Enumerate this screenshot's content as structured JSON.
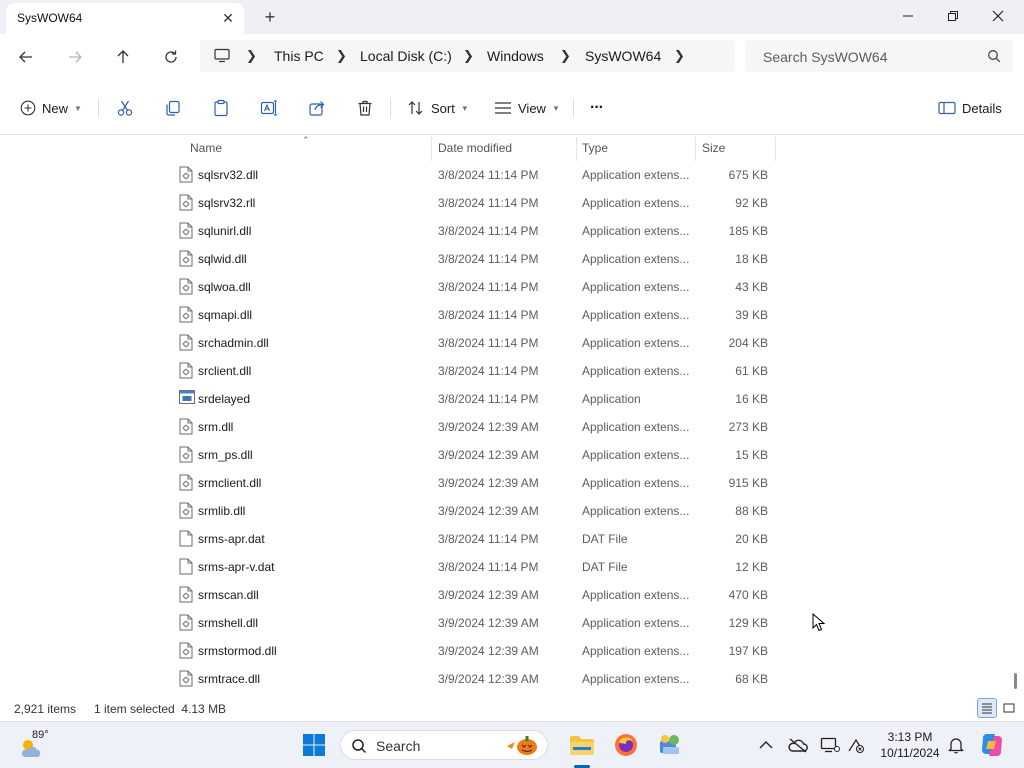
{
  "window": {
    "tab_title": "SysWOW64",
    "tab_close": "✕",
    "new_tab": "+"
  },
  "address": {
    "crumbs": [
      "This PC",
      "Local Disk (C:)",
      "Windows",
      "SysWOW64"
    ],
    "search_placeholder": "Search SysWOW64"
  },
  "toolbar": {
    "new_label": "New",
    "sort_label": "Sort",
    "view_label": "View",
    "more_label": "···",
    "details_label": "Details"
  },
  "columns": {
    "name": "Name",
    "date": "Date modified",
    "type": "Type",
    "size": "Size"
  },
  "files": [
    {
      "name": "sqlsrv32.dll",
      "date": "3/8/2024 11:14 PM",
      "type": "Application extens...",
      "size": "675 KB",
      "icon": "dll-icon"
    },
    {
      "name": "sqlsrv32.rll",
      "date": "3/8/2024 11:14 PM",
      "type": "Application extens...",
      "size": "92 KB",
      "icon": "dll-icon"
    },
    {
      "name": "sqlunirl.dll",
      "date": "3/8/2024 11:14 PM",
      "type": "Application extens...",
      "size": "185 KB",
      "icon": "dll-icon"
    },
    {
      "name": "sqlwid.dll",
      "date": "3/8/2024 11:14 PM",
      "type": "Application extens...",
      "size": "18 KB",
      "icon": "dll-icon"
    },
    {
      "name": "sqlwoa.dll",
      "date": "3/8/2024 11:14 PM",
      "type": "Application extens...",
      "size": "43 KB",
      "icon": "dll-icon"
    },
    {
      "name": "sqmapi.dll",
      "date": "3/8/2024 11:14 PM",
      "type": "Application extens...",
      "size": "39 KB",
      "icon": "dll-icon"
    },
    {
      "name": "srchadmin.dll",
      "date": "3/8/2024 11:14 PM",
      "type": "Application extens...",
      "size": "204 KB",
      "icon": "dll-icon"
    },
    {
      "name": "srclient.dll",
      "date": "3/8/2024 11:14 PM",
      "type": "Application extens...",
      "size": "61 KB",
      "icon": "dll-icon"
    },
    {
      "name": "srdelayed",
      "date": "3/8/2024 11:14 PM",
      "type": "Application",
      "size": "16 KB",
      "icon": "exe-icon"
    },
    {
      "name": "srm.dll",
      "date": "3/9/2024 12:39 AM",
      "type": "Application extens...",
      "size": "273 KB",
      "icon": "dll-icon"
    },
    {
      "name": "srm_ps.dll",
      "date": "3/9/2024 12:39 AM",
      "type": "Application extens...",
      "size": "15 KB",
      "icon": "dll-icon"
    },
    {
      "name": "srmclient.dll",
      "date": "3/9/2024 12:39 AM",
      "type": "Application extens...",
      "size": "915 KB",
      "icon": "dll-icon"
    },
    {
      "name": "srmlib.dll",
      "date": "3/9/2024 12:39 AM",
      "type": "Application extens...",
      "size": "88 KB",
      "icon": "dll-icon"
    },
    {
      "name": "srms-apr.dat",
      "date": "3/8/2024 11:14 PM",
      "type": "DAT File",
      "size": "20 KB",
      "icon": "dat-icon"
    },
    {
      "name": "srms-apr-v.dat",
      "date": "3/8/2024 11:14 PM",
      "type": "DAT File",
      "size": "12 KB",
      "icon": "dat-icon"
    },
    {
      "name": "srmscan.dll",
      "date": "3/9/2024 12:39 AM",
      "type": "Application extens...",
      "size": "470 KB",
      "icon": "dll-icon"
    },
    {
      "name": "srmshell.dll",
      "date": "3/9/2024 12:39 AM",
      "type": "Application extens...",
      "size": "129 KB",
      "icon": "dll-icon"
    },
    {
      "name": "srmstormod.dll",
      "date": "3/9/2024 12:39 AM",
      "type": "Application extens...",
      "size": "197 KB",
      "icon": "dll-icon"
    },
    {
      "name": "srmtrace.dll",
      "date": "3/9/2024 12:39 AM",
      "type": "Application extens...",
      "size": "68 KB",
      "icon": "dll-icon"
    }
  ],
  "status": {
    "item_count": "2,921 items",
    "selection": "1 item selected  4.13 MB"
  },
  "taskbar": {
    "temperature": "89°",
    "search_label": "Search",
    "time": "3:13 PM",
    "date": "10/11/2024",
    "accent": "#0067c0"
  }
}
